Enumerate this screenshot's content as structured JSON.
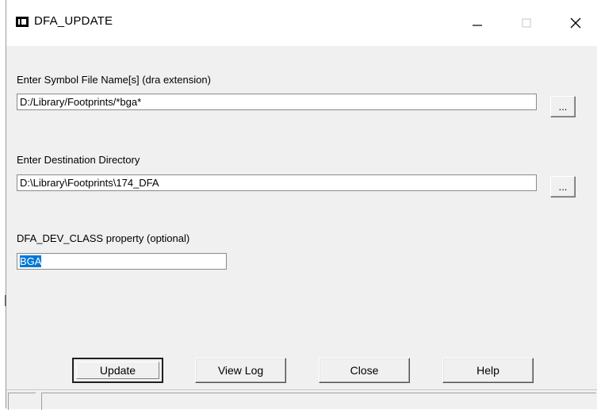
{
  "window": {
    "title": "DFA_UPDATE",
    "icon": "window-app-icon",
    "controls": {
      "minimize_icon": "minimize-icon",
      "maximize_icon": "maximize-icon",
      "close_icon": "close-icon"
    }
  },
  "form": {
    "symbol_files": {
      "label": "Enter Symbol File Name[s] (dra extension)",
      "value": "D:/Library/Footprints/*bga*",
      "browse_label": "..."
    },
    "destination": {
      "label": "Enter Destination Directory",
      "value": "D:\\Library\\Footprints\\174_DFA",
      "browse_label": "..."
    },
    "dev_class": {
      "label": "DFA_DEV_CLASS property (optional)",
      "value": "BGA",
      "selected": true
    }
  },
  "buttons": {
    "update": "Update",
    "view_log": "View Log",
    "close": "Close",
    "help": "Help"
  },
  "colors": {
    "selection": "#0078d7",
    "window_bg": "#f0f0f0"
  }
}
